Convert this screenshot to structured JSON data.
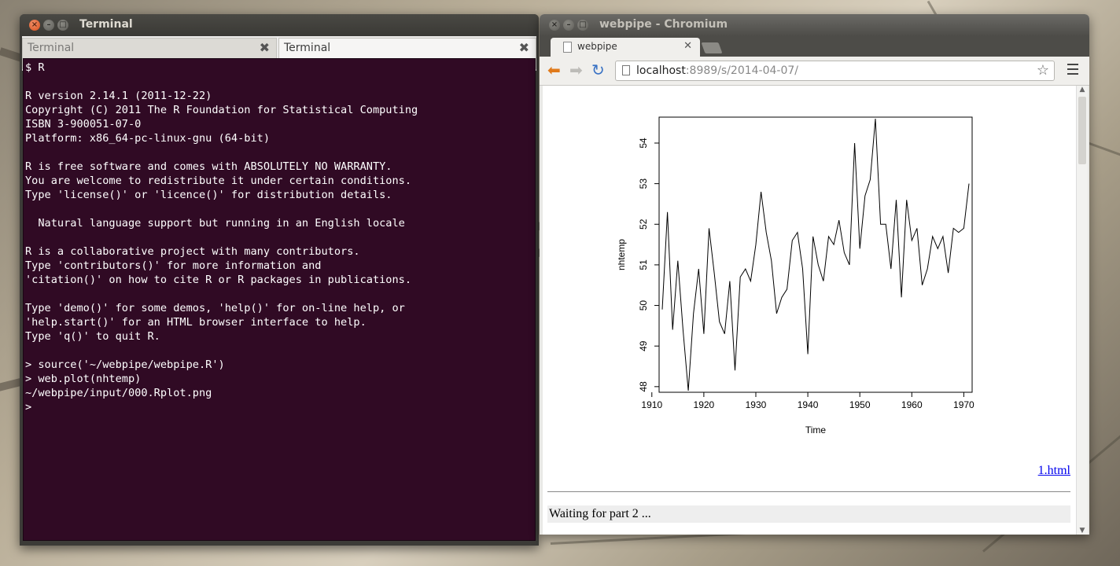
{
  "terminal": {
    "title": "Terminal",
    "tabs": [
      {
        "label": "Terminal",
        "active": false
      },
      {
        "label": "Terminal",
        "active": true
      }
    ],
    "lines": [
      "$ R",
      "",
      "R version 2.14.1 (2011-12-22)",
      "Copyright (C) 2011 The R Foundation for Statistical Computing",
      "ISBN 3-900051-07-0",
      "Platform: x86_64-pc-linux-gnu (64-bit)",
      "",
      "R is free software and comes with ABSOLUTELY NO WARRANTY.",
      "You are welcome to redistribute it under certain conditions.",
      "Type 'license()' or 'licence()' for distribution details.",
      "",
      "  Natural language support but running in an English locale",
      "",
      "R is a collaborative project with many contributors.",
      "Type 'contributors()' for more information and",
      "'citation()' on how to cite R or R packages in publications.",
      "",
      "Type 'demo()' for some demos, 'help()' for on-line help, or",
      "'help.start()' for an HTML browser interface to help.",
      "Type 'q()' to quit R.",
      "",
      "> source('~/webpipe/webpipe.R')",
      "> web.plot(nhtemp)",
      "~/webpipe/input/000.Rplot.png",
      ">"
    ],
    "colors": {
      "background": "#300a24",
      "text": "#ffffff"
    }
  },
  "browser": {
    "title": "webpipe - Chromium",
    "tab_label": "webpipe",
    "url_host": "localhost",
    "url_rest": ":8989/s/2014-04-07/",
    "link_label": "1.html",
    "status_text": "Waiting for part 2 ..."
  },
  "chart_data": {
    "type": "line",
    "xlabel": "Time",
    "ylabel": "nhtemp",
    "xlim": [
      1912,
      1971
    ],
    "ylim": [
      47.9,
      54.6
    ],
    "x_ticks": [
      1910,
      1920,
      1930,
      1940,
      1950,
      1960,
      1970
    ],
    "y_ticks": [
      48,
      49,
      50,
      51,
      52,
      53,
      54
    ],
    "x": [
      1912,
      1913,
      1914,
      1915,
      1916,
      1917,
      1918,
      1919,
      1920,
      1921,
      1922,
      1923,
      1924,
      1925,
      1926,
      1927,
      1928,
      1929,
      1930,
      1931,
      1932,
      1933,
      1934,
      1935,
      1936,
      1937,
      1938,
      1939,
      1940,
      1941,
      1942,
      1943,
      1944,
      1945,
      1946,
      1947,
      1948,
      1949,
      1950,
      1951,
      1952,
      1953,
      1954,
      1955,
      1956,
      1957,
      1958,
      1959,
      1960,
      1961,
      1962,
      1963,
      1964,
      1965,
      1966,
      1967,
      1968,
      1969,
      1970,
      1971
    ],
    "values": [
      49.9,
      52.3,
      49.4,
      51.1,
      49.4,
      47.9,
      49.8,
      50.9,
      49.3,
      51.9,
      50.8,
      49.6,
      49.3,
      50.6,
      48.4,
      50.7,
      50.9,
      50.6,
      51.5,
      52.8,
      51.8,
      51.1,
      49.8,
      50.2,
      50.4,
      51.6,
      51.8,
      50.9,
      48.8,
      51.7,
      51.0,
      50.6,
      51.7,
      51.5,
      52.1,
      51.3,
      51.0,
      54.0,
      51.4,
      52.7,
      53.1,
      54.6,
      52.0,
      52.0,
      50.9,
      52.6,
      50.2,
      52.6,
      51.6,
      51.9,
      50.5,
      50.9,
      51.7,
      51.4,
      51.7,
      50.8,
      51.9,
      51.8,
      51.9,
      53.0
    ],
    "grid": false,
    "line_color": "#000000"
  }
}
